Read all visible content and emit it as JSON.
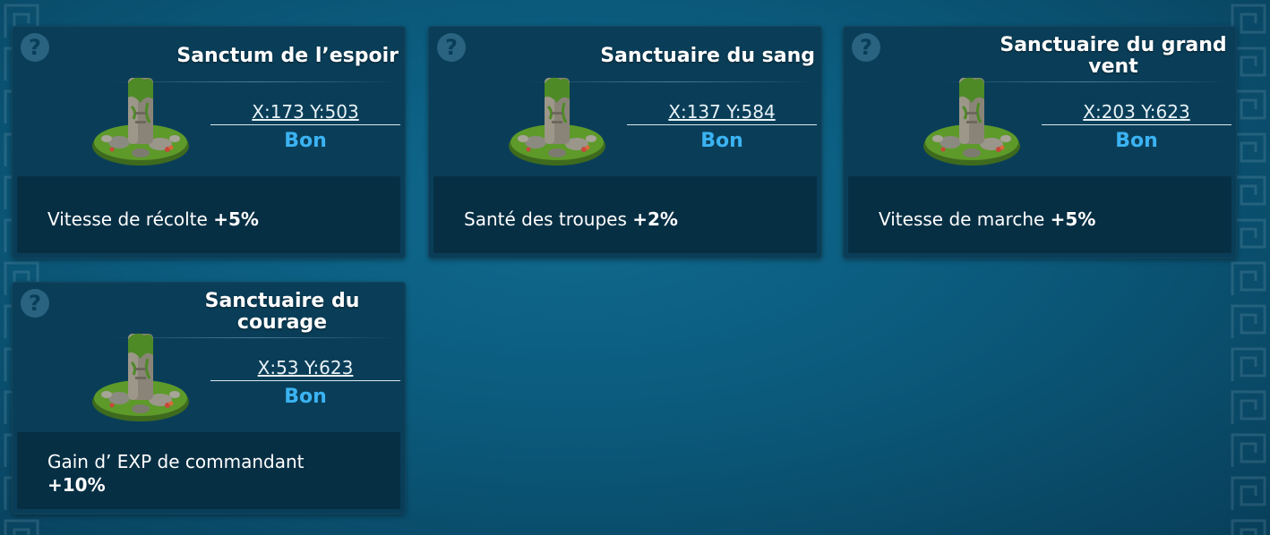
{
  "help_symbol": "?",
  "cards": [
    {
      "title": "Sanctum de l’espoir",
      "coords": "X:173 Y:503",
      "status": "Bon",
      "bonus_label": "Vitesse de récolte",
      "bonus_value": "+5%"
    },
    {
      "title": "Sanctuaire du sang",
      "coords": "X:137 Y:584",
      "status": "Bon",
      "bonus_label": "Santé des troupes",
      "bonus_value": "+2%"
    },
    {
      "title": "Sanctuaire du grand vent",
      "coords": "X:203 Y:623",
      "status": "Bon",
      "bonus_label": "Vitesse de marche",
      "bonus_value": "+5%"
    },
    {
      "title": "Sanctuaire du courage",
      "coords": "X:53 Y:623",
      "status": "Bon",
      "bonus_label": "Gain d’ EXP de commandant",
      "bonus_value": "+10%"
    }
  ],
  "colors": {
    "status": "#3bb3f2",
    "card_background": "#0a3e58",
    "bonus_panel": "#072f44",
    "page_background": "#0b5a7c"
  },
  "icons": {
    "help": "question-mark-icon",
    "shrine": "shrine-pillar-icon"
  }
}
